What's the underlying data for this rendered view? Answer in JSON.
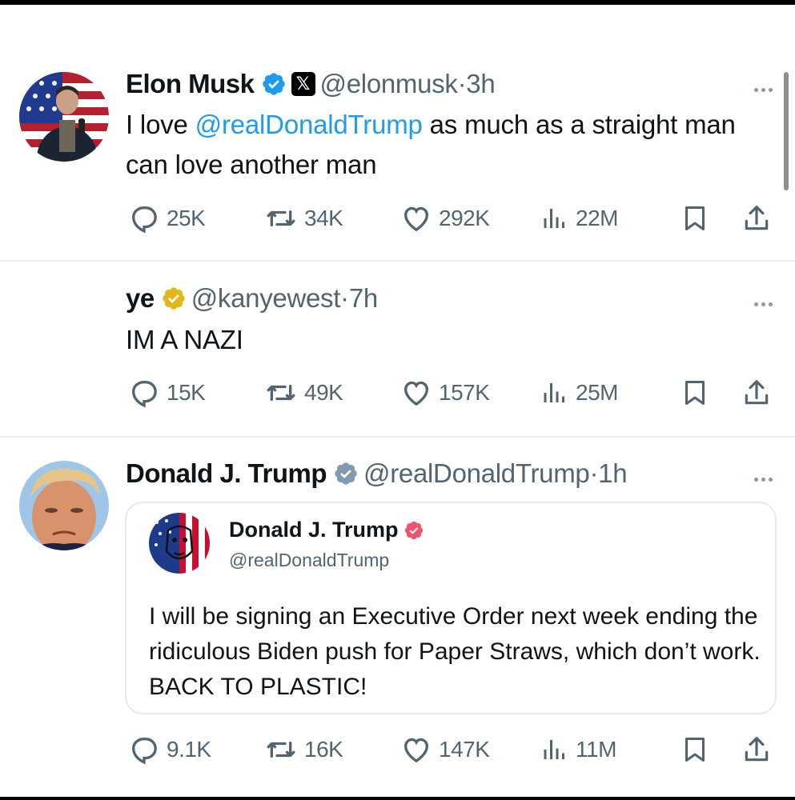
{
  "tweets": [
    {
      "name": "Elon Musk",
      "badge_color": "#1d9bf0",
      "has_x_logo": true,
      "x_logo_icon": "x-logo-icon",
      "handle": "@elonmusk",
      "time": "3h",
      "text_pre": "I love ",
      "text_mention": "@realDonaldTrump",
      "text_post": " as much as a straight man can love another man",
      "stats": {
        "replies": "25K",
        "reposts": "34K",
        "likes": "292K",
        "views": "22M"
      }
    },
    {
      "name": "ye",
      "badge_color": "#e2b719",
      "handle": "@kanyewest",
      "time": "7h",
      "text": "IM A NAZI",
      "stats": {
        "replies": "15K",
        "reposts": "49K",
        "likes": "157K",
        "views": "25M"
      }
    },
    {
      "name": "Donald J. Trump",
      "badge_color": "#829aab",
      "handle": "@realDonaldTrump",
      "time": "1h",
      "quote": {
        "name": "Donald J. Trump",
        "badge_color": "#f4516c",
        "handle": "@realDonaldTrump",
        "text": "I will be signing an Executive Order next week ending the ridiculous Biden push for Paper Straws, which don’t work. BACK TO PLASTIC!"
      },
      "stats": {
        "replies": "9.1K",
        "reposts": "16K",
        "likes": "147K",
        "views": "11M"
      }
    }
  ],
  "separator": " · ",
  "icons": [
    "reply-icon",
    "repost-icon",
    "like-icon",
    "views-icon",
    "bookmark-icon",
    "share-icon",
    "more-icon",
    "verified-badge-icon"
  ]
}
